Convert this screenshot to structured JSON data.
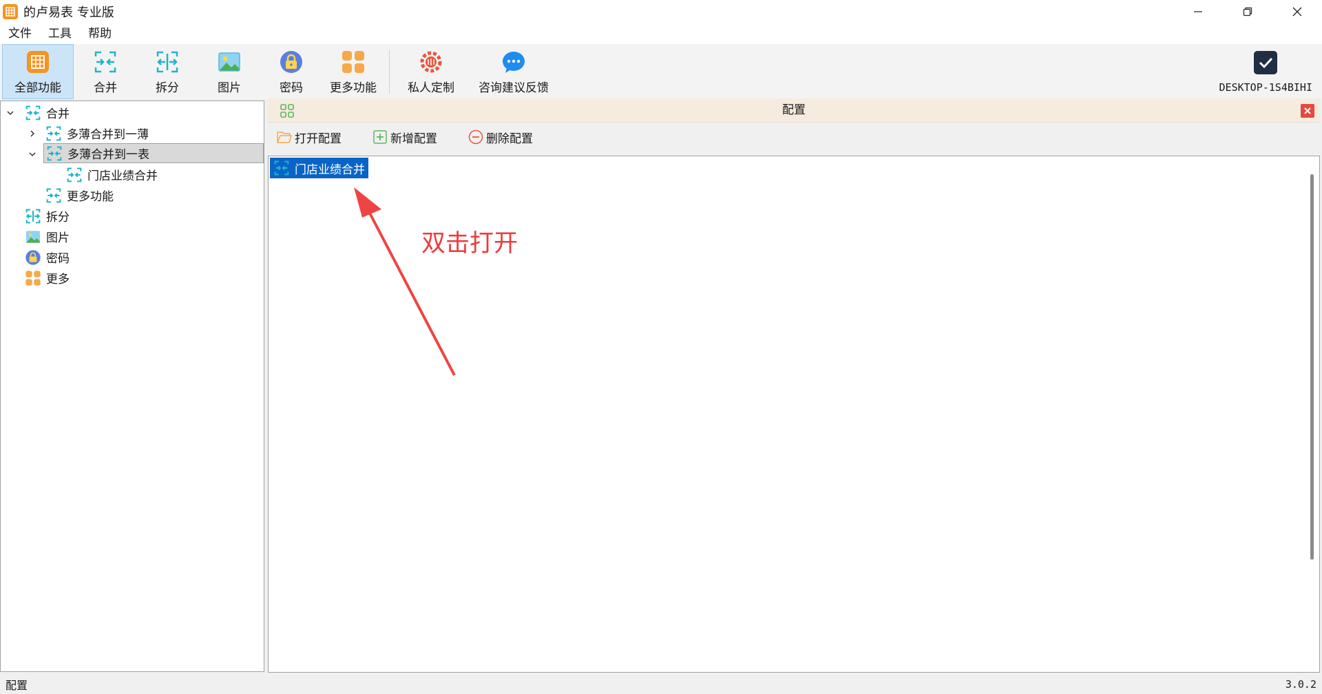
{
  "window": {
    "title": "的卢易表 专业版",
    "controls": [
      "minimize",
      "maximize",
      "close"
    ]
  },
  "menu": {
    "items": [
      "文件",
      "工具",
      "帮助"
    ]
  },
  "toolbar": {
    "buttons": [
      {
        "label": "全部功能",
        "icon": "all-features-icon",
        "active": true
      },
      {
        "label": "合并",
        "icon": "merge-icon"
      },
      {
        "label": "拆分",
        "icon": "split-icon"
      },
      {
        "label": "图片",
        "icon": "image-icon"
      },
      {
        "label": "密码",
        "icon": "lock-icon"
      },
      {
        "label": "更多功能",
        "icon": "more-grid-icon"
      },
      {
        "label": "私人定制",
        "icon": "customize-icon"
      },
      {
        "label": "咨询建议反馈",
        "icon": "chat-icon"
      }
    ],
    "user_label": "DESKTOP-1S4BIHI"
  },
  "tree": {
    "items": [
      {
        "label": "合并",
        "level": 0,
        "expanded": true
      },
      {
        "label": "多薄合并到一薄",
        "level": 1,
        "expanded": false
      },
      {
        "label": "多薄合并到一表",
        "level": 1,
        "expanded": true,
        "selected": true
      },
      {
        "label": "门店业绩合并",
        "level": 2
      },
      {
        "label": "更多功能",
        "level": 1
      },
      {
        "label": "拆分",
        "level": 0
      },
      {
        "label": "图片",
        "level": 0
      },
      {
        "label": "密码",
        "level": 0
      },
      {
        "label": "更多",
        "level": 0
      }
    ]
  },
  "config": {
    "title": "配置",
    "actions": {
      "open": "打开配置",
      "add": "新增配置",
      "delete": "删除配置"
    },
    "list": [
      {
        "label": "门店业绩合并",
        "selected": true
      }
    ]
  },
  "annotation": {
    "text": "双击打开",
    "color": "#ee3b3b"
  },
  "status": {
    "left": "配置",
    "version": "3.0.2"
  },
  "colors": {
    "accent": "#0a64c8",
    "selection": "#cce4f7",
    "header_bg": "#f5ebdf",
    "close_red": "#e8493f"
  }
}
